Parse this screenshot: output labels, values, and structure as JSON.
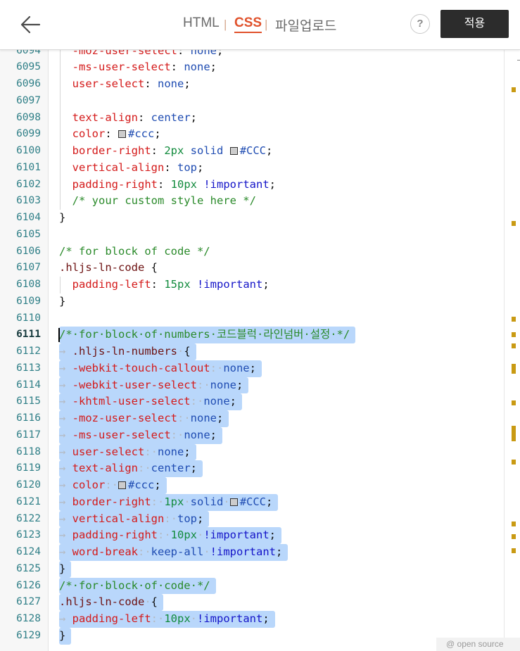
{
  "header": {
    "tabs": [
      "HTML",
      "CSS",
      "파일업로드"
    ],
    "separator": "|",
    "help_label": "?",
    "apply_label": "적용"
  },
  "editor": {
    "language": "CSS",
    "current_line": "6111",
    "colors": {
      "property": "#d41a1a",
      "value": "#1f4cb2",
      "number": "#128b3d",
      "important": "#1414c8",
      "comment": "#2a8a2a",
      "selector": "#6d1111",
      "selection": "#b9d7fb",
      "gutter": "#f7f7f7",
      "overview_mark": "#c99a13",
      "swatch_ccc": "#cccccc",
      "accent_tab": "#e0512b"
    },
    "lines": [
      {
        "n": "6094",
        "sel": false,
        "g": true,
        "t": [
          [
            "  "
          ],
          [
            "-moz-user-select",
            "p"
          ],
          [
            ": "
          ],
          [
            "none",
            "v"
          ],
          [
            ";"
          ]
        ]
      },
      {
        "n": "6095",
        "sel": false,
        "g": true,
        "t": [
          [
            "  "
          ],
          [
            "-ms-user-select",
            "p"
          ],
          [
            ": "
          ],
          [
            "none",
            "v"
          ],
          [
            ";"
          ]
        ]
      },
      {
        "n": "6096",
        "sel": false,
        "g": true,
        "t": [
          [
            "  "
          ],
          [
            "user-select",
            "p"
          ],
          [
            ": "
          ],
          [
            "none",
            "v"
          ],
          [
            ";"
          ]
        ]
      },
      {
        "n": "6097",
        "sel": false,
        "g": true,
        "t": []
      },
      {
        "n": "6098",
        "sel": false,
        "g": true,
        "t": [
          [
            "  "
          ],
          [
            "text-align",
            "p"
          ],
          [
            ": "
          ],
          [
            "center",
            "v"
          ],
          [
            ";"
          ]
        ]
      },
      {
        "n": "6099",
        "sel": false,
        "g": true,
        "t": [
          [
            "  "
          ],
          [
            "color",
            "p"
          ],
          [
            ": "
          ],
          [
            "",
            "sw"
          ],
          [
            "#ccc",
            "v"
          ],
          [
            ";"
          ]
        ]
      },
      {
        "n": "6100",
        "sel": false,
        "g": true,
        "t": [
          [
            "  "
          ],
          [
            "border-right",
            "p"
          ],
          [
            ": "
          ],
          [
            "2px",
            "n"
          ],
          [
            " "
          ],
          [
            "solid",
            "v"
          ],
          [
            " "
          ],
          [
            "",
            "sw"
          ],
          [
            "#CCC",
            "v"
          ],
          [
            ";"
          ]
        ]
      },
      {
        "n": "6101",
        "sel": false,
        "g": true,
        "t": [
          [
            "  "
          ],
          [
            "vertical-align",
            "p"
          ],
          [
            ": "
          ],
          [
            "top",
            "v"
          ],
          [
            ";"
          ]
        ]
      },
      {
        "n": "6102",
        "sel": false,
        "g": true,
        "t": [
          [
            "  "
          ],
          [
            "padding-right",
            "p"
          ],
          [
            ": "
          ],
          [
            "10px",
            "n"
          ],
          [
            " "
          ],
          [
            "!important",
            "i"
          ],
          [
            ";"
          ]
        ]
      },
      {
        "n": "6103",
        "sel": false,
        "g": true,
        "t": [
          [
            "  "
          ],
          [
            "/* your custom style here */",
            "c"
          ]
        ]
      },
      {
        "n": "6104",
        "sel": false,
        "g": false,
        "t": [
          [
            "}"
          ]
        ]
      },
      {
        "n": "6105",
        "sel": false,
        "g": false,
        "t": []
      },
      {
        "n": "6106",
        "sel": false,
        "g": false,
        "t": [
          [
            "/* for block of code */",
            "c"
          ]
        ]
      },
      {
        "n": "6107",
        "sel": false,
        "g": false,
        "t": [
          [
            ".hljs-ln-code",
            "s"
          ],
          [
            " {"
          ]
        ]
      },
      {
        "n": "6108",
        "sel": false,
        "g": true,
        "t": [
          [
            "  "
          ],
          [
            "padding-left",
            "p"
          ],
          [
            ": "
          ],
          [
            "15px",
            "n"
          ],
          [
            " "
          ],
          [
            "!important",
            "i"
          ],
          [
            ";"
          ]
        ]
      },
      {
        "n": "6109",
        "sel": false,
        "g": false,
        "t": [
          [
            "}"
          ]
        ]
      },
      {
        "n": "6110",
        "sel": false,
        "g": false,
        "t": []
      },
      {
        "n": "6111",
        "sel": true,
        "g": false,
        "t": [
          [
            "/*·for·block·of·numbers·코드블럭·라인넘버·설정·*/",
            "c"
          ]
        ]
      },
      {
        "n": "6112",
        "sel": true,
        "g": false,
        "t": [
          [
            "→ ",
            "w"
          ],
          [
            ".hljs-ln-numbers",
            "s"
          ],
          [
            "·",
            "w"
          ],
          [
            "{"
          ]
        ]
      },
      {
        "n": "6113",
        "sel": true,
        "g": false,
        "t": [
          [
            "→ ",
            "w"
          ],
          [
            "-webkit-touch-callout",
            "p"
          ],
          [
            ":·",
            "w"
          ],
          [
            "none",
            "v"
          ],
          [
            ";"
          ]
        ]
      },
      {
        "n": "6114",
        "sel": true,
        "g": false,
        "t": [
          [
            "→ ",
            "w"
          ],
          [
            "-webkit-user-select",
            "p"
          ],
          [
            ":·",
            "w"
          ],
          [
            "none",
            "v"
          ],
          [
            ";"
          ]
        ]
      },
      {
        "n": "6115",
        "sel": true,
        "g": false,
        "t": [
          [
            "→ ",
            "w"
          ],
          [
            "-khtml-user-select",
            "p"
          ],
          [
            ":·",
            "w"
          ],
          [
            "none",
            "v"
          ],
          [
            ";"
          ]
        ]
      },
      {
        "n": "6116",
        "sel": true,
        "g": false,
        "t": [
          [
            "→ ",
            "w"
          ],
          [
            "-moz-user-select",
            "p"
          ],
          [
            ":·",
            "w"
          ],
          [
            "none",
            "v"
          ],
          [
            ";"
          ]
        ]
      },
      {
        "n": "6117",
        "sel": true,
        "g": false,
        "t": [
          [
            "→ ",
            "w"
          ],
          [
            "-ms-user-select",
            "p"
          ],
          [
            ":·",
            "w"
          ],
          [
            "none",
            "v"
          ],
          [
            ";"
          ]
        ]
      },
      {
        "n": "6118",
        "sel": true,
        "g": false,
        "t": [
          [
            "→ ",
            "w"
          ],
          [
            "user-select",
            "p"
          ],
          [
            ":·",
            "w"
          ],
          [
            "none",
            "v"
          ],
          [
            ";"
          ]
        ]
      },
      {
        "n": "6119",
        "sel": true,
        "g": false,
        "t": [
          [
            "→ ",
            "w"
          ],
          [
            "text-align",
            "p"
          ],
          [
            ":·",
            "w"
          ],
          [
            "center",
            "v"
          ],
          [
            ";"
          ]
        ]
      },
      {
        "n": "6120",
        "sel": true,
        "g": false,
        "t": [
          [
            "→ ",
            "w"
          ],
          [
            "color",
            "p"
          ],
          [
            ":·",
            "w"
          ],
          [
            "",
            "sw"
          ],
          [
            "#ccc",
            "v"
          ],
          [
            ";"
          ]
        ]
      },
      {
        "n": "6121",
        "sel": true,
        "g": false,
        "t": [
          [
            "→ ",
            "w"
          ],
          [
            "border-right",
            "p"
          ],
          [
            ":·",
            "w"
          ],
          [
            "1px",
            "n"
          ],
          [
            "·",
            "w"
          ],
          [
            "solid",
            "v"
          ],
          [
            "·",
            "w"
          ],
          [
            "",
            "sw"
          ],
          [
            "#CCC",
            "v"
          ],
          [
            ";"
          ]
        ]
      },
      {
        "n": "6122",
        "sel": true,
        "g": false,
        "t": [
          [
            "→ ",
            "w"
          ],
          [
            "vertical-align",
            "p"
          ],
          [
            ":·",
            "w"
          ],
          [
            "top",
            "v"
          ],
          [
            ";"
          ]
        ]
      },
      {
        "n": "6123",
        "sel": true,
        "g": false,
        "t": [
          [
            "→ ",
            "w"
          ],
          [
            "padding-right",
            "p"
          ],
          [
            ":·",
            "w"
          ],
          [
            "10px",
            "n"
          ],
          [
            "·",
            "w"
          ],
          [
            "!important",
            "i"
          ],
          [
            ";"
          ]
        ]
      },
      {
        "n": "6124",
        "sel": true,
        "g": false,
        "t": [
          [
            "→ ",
            "w"
          ],
          [
            "word-break",
            "p"
          ],
          [
            ":·",
            "w"
          ],
          [
            "keep-all",
            "v"
          ],
          [
            "·",
            "w"
          ],
          [
            "!important",
            "i"
          ],
          [
            ";"
          ]
        ]
      },
      {
        "n": "6125",
        "sel": true,
        "g": false,
        "t": [
          [
            "}"
          ]
        ]
      },
      {
        "n": "6126",
        "sel": true,
        "g": false,
        "t": [
          [
            "/*·for·block·of·code·*/",
            "c"
          ]
        ]
      },
      {
        "n": "6127",
        "sel": true,
        "g": false,
        "t": [
          [
            ".hljs-ln-code",
            "s"
          ],
          [
            "·",
            "w"
          ],
          [
            "{"
          ]
        ]
      },
      {
        "n": "6128",
        "sel": true,
        "g": false,
        "t": [
          [
            "→ ",
            "w"
          ],
          [
            "padding-left",
            "p"
          ],
          [
            ":·",
            "w"
          ],
          [
            "10px",
            "n"
          ],
          [
            "·",
            "w"
          ],
          [
            "!important",
            "i"
          ],
          [
            ";"
          ]
        ]
      },
      {
        "n": "6129",
        "sel": true,
        "g": false,
        "t": [
          [
            "}"
          ]
        ]
      }
    ]
  },
  "footer": {
    "open_source_label": "@ open source"
  }
}
